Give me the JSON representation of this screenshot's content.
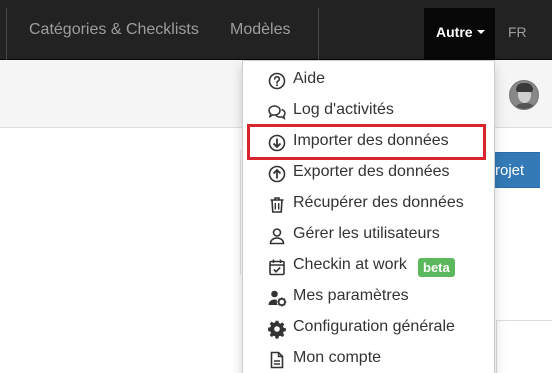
{
  "nav": {
    "items": [
      {
        "label": "Catégories & Checklists"
      },
      {
        "label": "Modèles"
      }
    ],
    "active_label": "Autre",
    "lang": "FR"
  },
  "main": {
    "button_partial": "rojet"
  },
  "dropdown": {
    "items": [
      {
        "icon": "question-circle-icon",
        "label": "Aide"
      },
      {
        "icon": "comments-icon",
        "label": "Log d'activités"
      },
      {
        "icon": "arrow-circle-down-icon",
        "label": "Importer des données"
      },
      {
        "icon": "arrow-circle-up-icon",
        "label": "Exporter des données"
      },
      {
        "icon": "trash-icon",
        "label": "Récupérer des données"
      },
      {
        "icon": "user-icon",
        "label": "Gérer les utilisateurs"
      },
      {
        "icon": "calendar-check-icon",
        "label": "Checkin at work",
        "badge": "beta"
      },
      {
        "icon": "user-cog-icon",
        "label": "Mes paramètres"
      },
      {
        "icon": "gear-icon",
        "label": "Configuration générale"
      },
      {
        "icon": "file-icon",
        "label": "Mon compte"
      }
    ]
  },
  "colors": {
    "nav_bg": "#222222",
    "highlight_border": "#d9232d",
    "badge_bg": "#5cb85c",
    "primary_button": "#337ab7"
  }
}
